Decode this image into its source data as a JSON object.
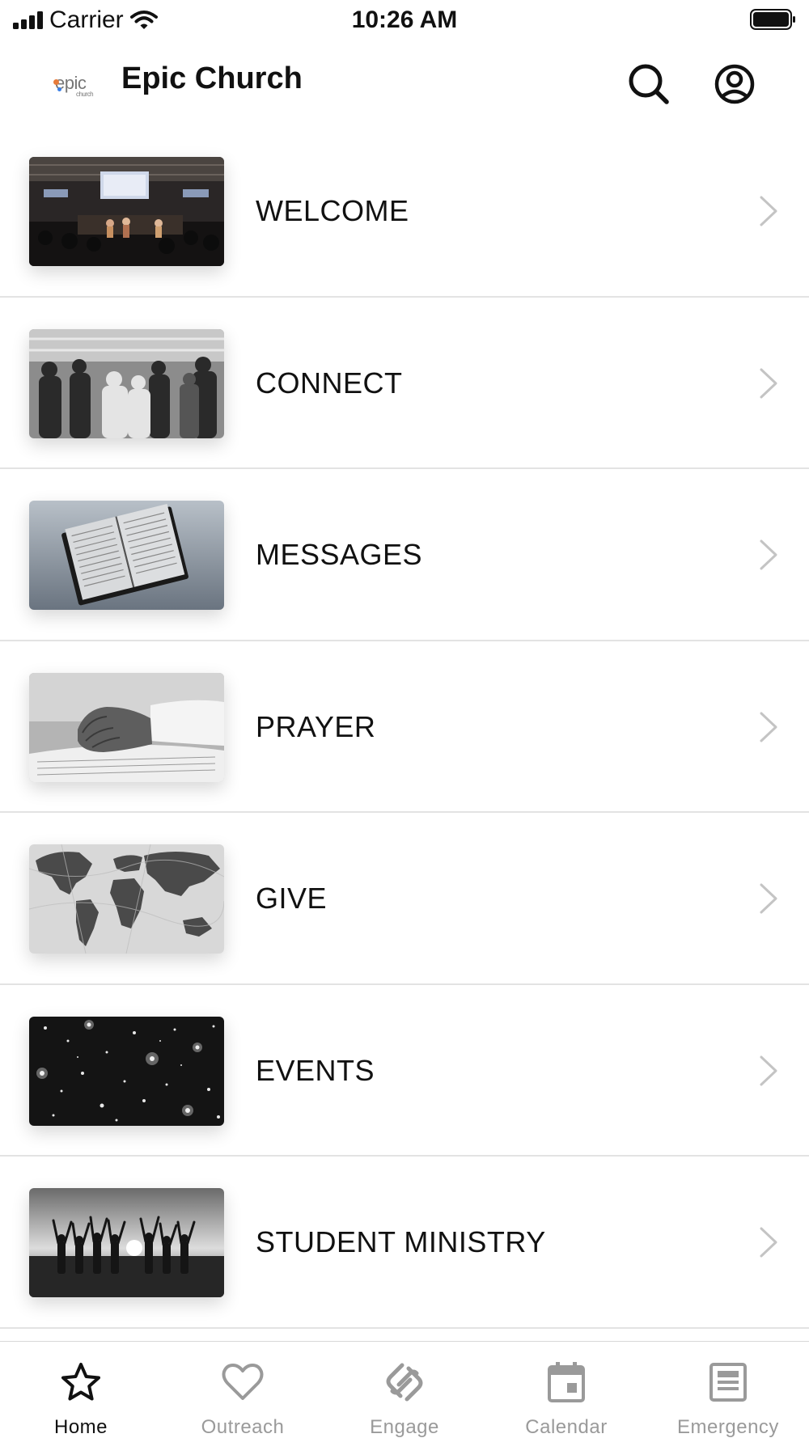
{
  "status_bar": {
    "carrier": "Carrier",
    "time": "10:26 AM"
  },
  "header": {
    "logo_text": "epic",
    "logo_sub": "church",
    "title": "Epic Church",
    "icons": [
      "search-icon",
      "profile-icon"
    ]
  },
  "menu": {
    "items": [
      {
        "label": "WELCOME",
        "image": "worship-stage-photo"
      },
      {
        "label": "CONNECT",
        "image": "congregation-praying-photo"
      },
      {
        "label": "MESSAGES",
        "image": "open-bible-photo"
      },
      {
        "label": "PRAYER",
        "image": "praying-hands-photo"
      },
      {
        "label": "GIVE",
        "image": "world-map-photo"
      },
      {
        "label": "EVENTS",
        "image": "starry-sky-photo"
      },
      {
        "label": "STUDENT MINISTRY",
        "image": "raised-hands-silhouette-photo"
      }
    ]
  },
  "tab_bar": {
    "tabs": [
      {
        "label": "Home",
        "icon": "star-icon",
        "active": true
      },
      {
        "label": "Outreach",
        "icon": "heart-icon",
        "active": false
      },
      {
        "label": "Engage",
        "icon": "engage-icon",
        "active": false
      },
      {
        "label": "Calendar",
        "icon": "calendar-icon",
        "active": false
      },
      {
        "label": "Emergency",
        "icon": "emergency-icon",
        "active": false
      }
    ]
  },
  "colors": {
    "active_tab": "#111111",
    "inactive_tab": "#9a9a9a",
    "divider": "#e3e3e3",
    "chevron": "#c4c4c4"
  }
}
